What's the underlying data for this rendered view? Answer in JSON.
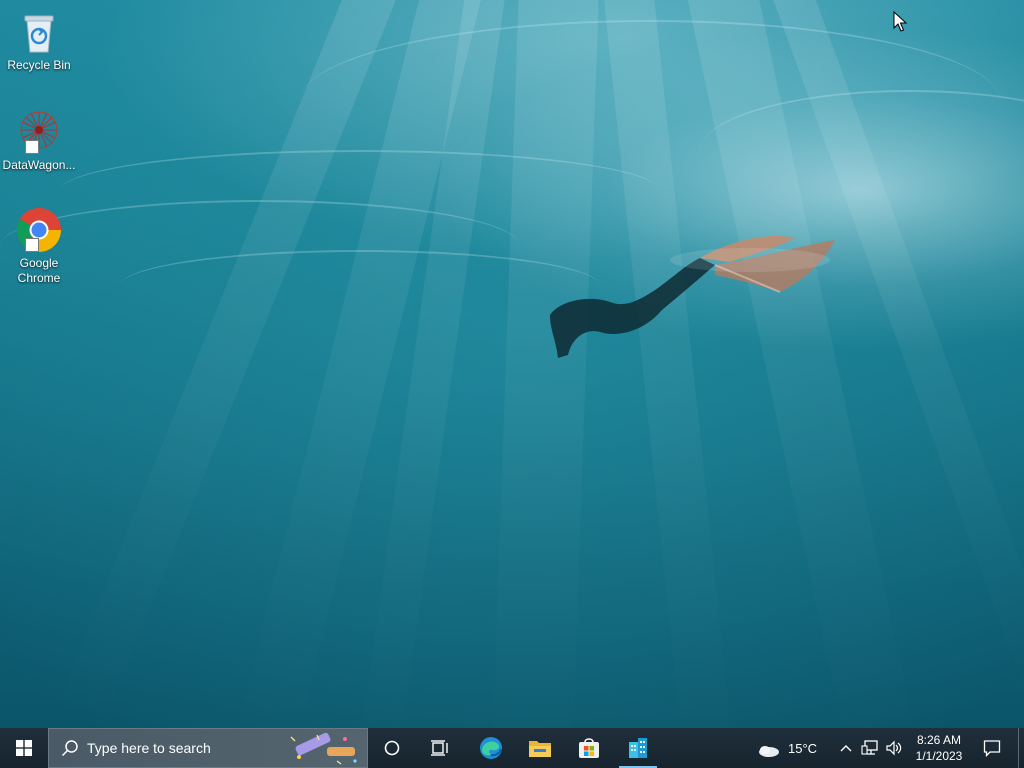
{
  "desktop": {
    "icons": [
      {
        "label": "Recycle Bin",
        "icon": "recycle-bin-icon"
      },
      {
        "label": "DataWagon...",
        "icon": "datawagon-icon"
      },
      {
        "label": "Google Chrome",
        "icon": "chrome-icon"
      }
    ]
  },
  "taskbar": {
    "start_icon": "windows-logo-icon",
    "search_placeholder": "Type here to search",
    "weather_temp": "15°C",
    "clock_time": "8:26 AM",
    "clock_date": "1/1/2023",
    "pinned": [
      {
        "icon": "cortana-icon"
      },
      {
        "icon": "task-view-icon"
      },
      {
        "icon": "edge-icon"
      },
      {
        "icon": "file-explorer-icon"
      },
      {
        "icon": "microsoft-store-icon"
      },
      {
        "icon": "building-app-icon"
      }
    ]
  },
  "colors": {
    "taskbar_bg": "#1b2a35",
    "active_indicator": "#7cc3ef",
    "water_top": "#1f8aa0",
    "water_bottom": "#0b5569"
  }
}
